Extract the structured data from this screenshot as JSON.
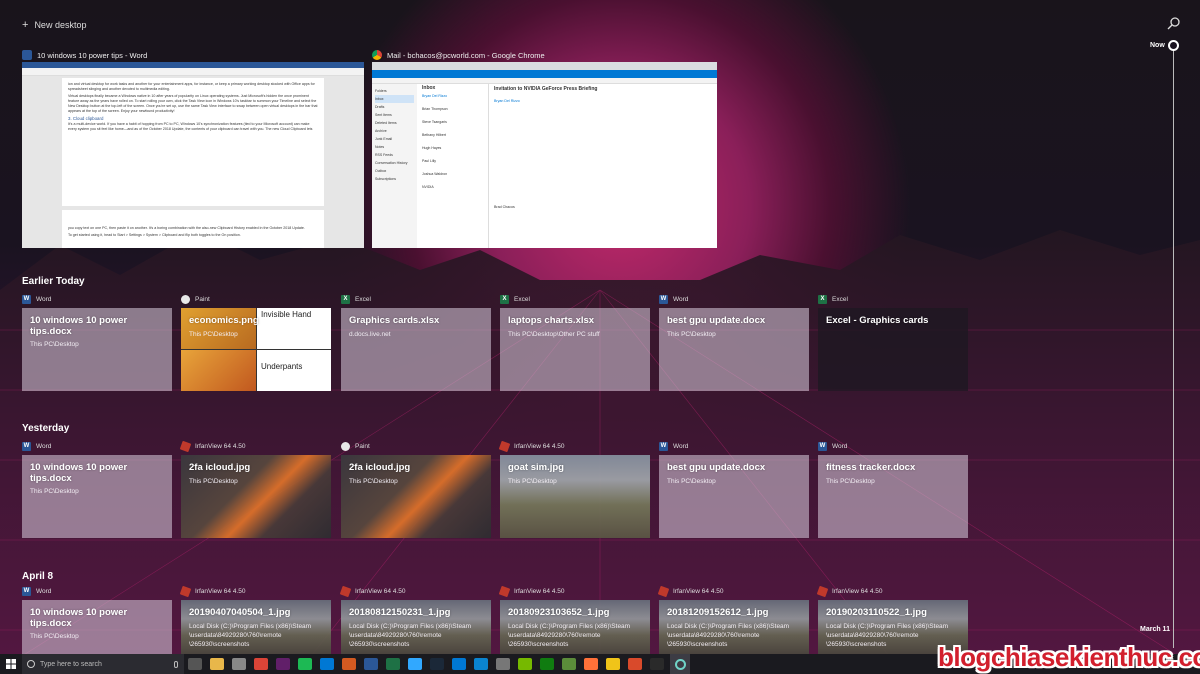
{
  "topbar": {
    "new_desktop": "New desktop",
    "plus": "+"
  },
  "timeline": {
    "now_label": "Now",
    "end_label": "March 11"
  },
  "windows": [
    {
      "title": "10 windows 10 power tips - Word",
      "icon": "word-icon"
    },
    {
      "title": "Mail - bchacos@pcworld.com - Google Chrome",
      "icon": "chrome-icon"
    }
  ],
  "word_doc": {
    "p1": "ion and virtual desktop for work tasks and another for your entertainment apps, for instance, or keep a primary working desktop stocked with Office apps for spreadsheet slinging and another devoted to multimedia editing.",
    "p2": "Virtual desktops finally became a Windows native in 10 after years of popularity on Linux operating systems. Just Microsoft's hidden the once prominent feature away as the years have rolled on. To start rolling your own, click the Task View icon in Windows 10's taskbar to summon your Timeline and select the New Desktop button at the top-left of the screen. Once you're set up, use the same Task View interface to swap between open virtual desktops in the bar that appears at the top of the screen. Enjoy your newfound productivity!",
    "h3": "3. Cloud clipboard",
    "p3": "It's a multi-device world. If you have a habit of hopping from PC to PC, Windows 10's synchronization features (tied to your Microsoft account) can make every system you sit feel like home—and as of the October 2018 Update, the contents of your clipboard can travel with you. The new Cloud Clipboard lets",
    "p4": "you copy text on one PC, then paste it on another. It's a boring combination with the also-new Clipboard History enabled in the October 2018 Update.",
    "p5": "To get started using it, head to Start > Settings > System > Clipboard and flip both toggles to the On position."
  },
  "mail": {
    "subject": "Invitation to NVIDIA GeForce Press Briefing",
    "inbox_label": "Inbox",
    "folders": [
      "Folders",
      "Inbox",
      "Drafts",
      "Sent Items",
      "Deleted Items",
      "Archive",
      "Junk Email",
      "Notes",
      "RSS Feeds",
      "Conversation History",
      "Outbox",
      "Subscriptions"
    ],
    "senders": [
      "Bryan Del Rizzo",
      "Brian Thompson",
      "Steve Tsangaris",
      "Bethany Hilbert",
      "Hugh Hayes",
      "Paul Lilly",
      "Joshua Waldron",
      "Brad Chacos",
      "NVIDIA"
    ]
  },
  "sections": [
    {
      "title": "Earlier Today",
      "cards": [
        {
          "app": "Word",
          "icon": "word",
          "title": "10 windows 10 power tips.docx",
          "sub": "This PC\\Desktop",
          "style": "light"
        },
        {
          "app": "Paint",
          "icon": "paint",
          "title": "economics.png",
          "sub": "This PC\\Desktop",
          "style": "meme",
          "meme_top": "Invisible Hand",
          "meme_bottom": "Underpants"
        },
        {
          "app": "Excel",
          "icon": "excel",
          "title": "Graphics cards.xlsx",
          "sub": "d.docs.live.net",
          "style": "light"
        },
        {
          "app": "Excel",
          "icon": "excel",
          "title": "laptops charts.xlsx",
          "sub": "This PC\\Desktop\\Other PC stuff",
          "style": "light"
        },
        {
          "app": "Word",
          "icon": "word",
          "title": "best gpu update.docx",
          "sub": "This PC\\Desktop",
          "style": "light"
        },
        {
          "app": "Excel",
          "icon": "excel",
          "title": "Excel - Graphics cards",
          "sub": "",
          "style": "dark"
        }
      ]
    },
    {
      "title": "Yesterday",
      "cards": [
        {
          "app": "Word",
          "icon": "word",
          "title": "10 windows 10 power tips.docx",
          "sub": "This PC\\Desktop",
          "style": "light"
        },
        {
          "app": "IrfanView 64 4.50",
          "icon": "irfan",
          "title": "2fa icloud.jpg",
          "sub": "This PC\\Desktop",
          "style": "photo1"
        },
        {
          "app": "Paint",
          "icon": "paint",
          "title": "2fa icloud.jpg",
          "sub": "This PC\\Desktop",
          "style": "photo1"
        },
        {
          "app": "IrfanView 64 4.50",
          "icon": "irfan",
          "title": "goat sim.jpg",
          "sub": "This PC\\Desktop",
          "style": "photo2"
        },
        {
          "app": "Word",
          "icon": "word",
          "title": "best gpu update.docx",
          "sub": "This PC\\Desktop",
          "style": "light"
        },
        {
          "app": "Word",
          "icon": "word",
          "title": "fitness tracker.docx",
          "sub": "This PC\\Desktop",
          "style": "light"
        }
      ]
    },
    {
      "title": "April 8",
      "cards": [
        {
          "app": "Word",
          "icon": "word",
          "title": "10 windows 10 power tips.docx",
          "sub": "This PC\\Desktop",
          "style": "light"
        },
        {
          "app": "IrfanView 64 4.50",
          "icon": "irfan",
          "title": "20190407040504_1.jpg",
          "sub": "Local Disk (C:)\\Program Files (x86)\\Steam \\userdata\\84929280\\760\\remote \\265930\\screenshots",
          "style": "photo3"
        },
        {
          "app": "IrfanView 64 4.50",
          "icon": "irfan",
          "title": "20180812150231_1.jpg",
          "sub": "Local Disk (C:)\\Program Files (x86)\\Steam \\userdata\\84929280\\760\\remote \\265930\\screenshots",
          "style": "photo3"
        },
        {
          "app": "IrfanView 64 4.50",
          "icon": "irfan",
          "title": "20180923103652_1.jpg",
          "sub": "Local Disk (C:)\\Program Files (x86)\\Steam \\userdata\\84929280\\760\\remote \\265930\\screenshots",
          "style": "photo3"
        },
        {
          "app": "IrfanView 64 4.50",
          "icon": "irfan",
          "title": "20181209152612_1.jpg",
          "sub": "Local Disk (C:)\\Program Files (x86)\\Steam \\userdata\\84929280\\760\\remote \\265930\\screenshots",
          "style": "photo3"
        },
        {
          "app": "IrfanView 64 4.50",
          "icon": "irfan",
          "title": "20190203110522_1.jpg",
          "sub": "Local Disk (C:)\\Program Files (x86)\\Steam \\userdata\\84929280\\760\\remote \\265930\\screenshots",
          "style": "photo3"
        }
      ]
    }
  ],
  "taskbar": {
    "search_placeholder": "Type here to search",
    "icons": [
      "task-view-icon",
      "file-explorer-icon",
      "media-player-icon",
      "chrome-icon",
      "slack-icon",
      "spotify-icon",
      "photos-icon",
      "app-icon",
      "word-icon",
      "excel-icon",
      "photoshop-icon",
      "steam-icon",
      "store-icon",
      "edge-icon",
      "settings-icon",
      "nvidia-icon",
      "xbox-icon",
      "minecraft-icon",
      "firefox-icon",
      "paint-icon",
      "app2-icon",
      "epic-games-icon"
    ]
  },
  "watermark": "blogchiasekienthuc.com"
}
